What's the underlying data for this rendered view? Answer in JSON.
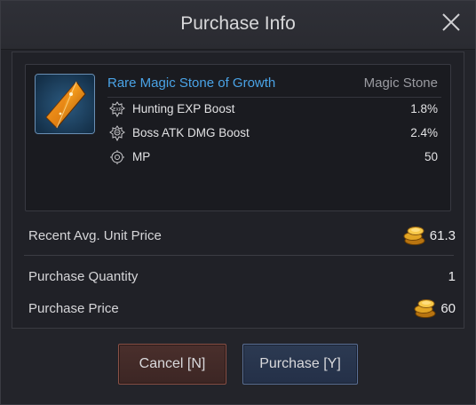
{
  "dialog": {
    "title": "Purchase Info",
    "close_icon": "close-icon"
  },
  "item": {
    "icon": "magic-stone-icon",
    "name": "Rare Magic Stone of Growth",
    "type": "Magic Stone",
    "stats": [
      {
        "icon": "exp-boost-icon",
        "label": "Hunting EXP Boost",
        "value": "1.8%"
      },
      {
        "icon": "skull-boost-icon",
        "label": "Boss ATK DMG Boost",
        "value": "2.4%"
      },
      {
        "icon": "mp-icon",
        "label": "MP",
        "value": "50"
      }
    ]
  },
  "recent_price": {
    "label": "Recent Avg. Unit Price",
    "value": "61.3",
    "icon": "gold-coin-icon"
  },
  "quantity": {
    "label": "Purchase Quantity",
    "value": "1"
  },
  "purchase_price": {
    "label": "Purchase Price",
    "value": "60",
    "icon": "gold-coin-icon"
  },
  "buttons": {
    "cancel": "Cancel [N]",
    "purchase": "Purchase [Y]"
  },
  "colors": {
    "item_name": "#4aa3e6",
    "cancel_border": "#8a5046",
    "purchase_border": "#5a6f95"
  }
}
